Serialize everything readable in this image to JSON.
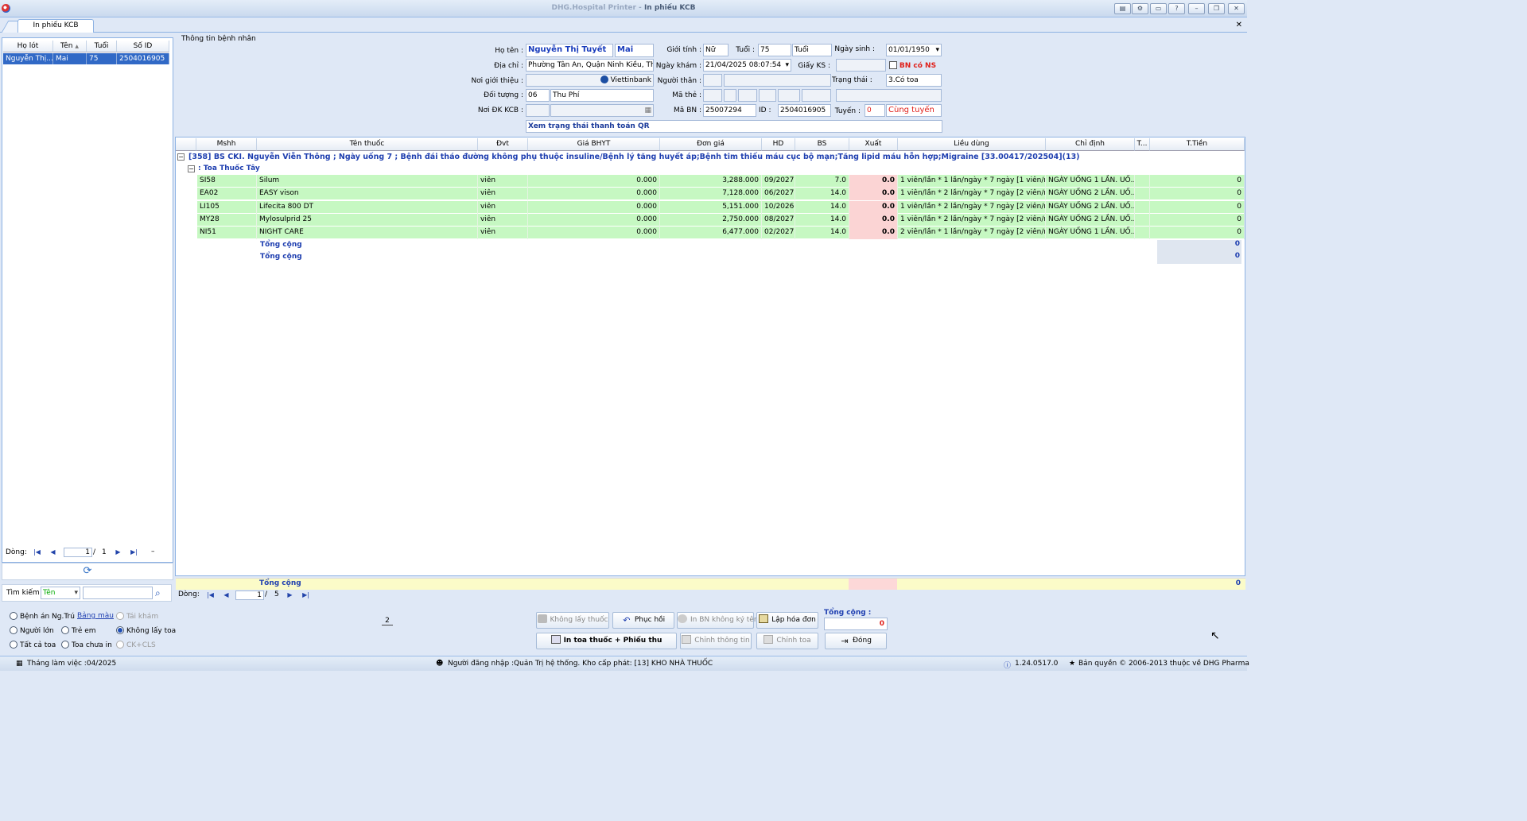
{
  "window": {
    "title_prefix": "DHG.Hospital Printer - ",
    "title": "In phiếu KCB"
  },
  "tab": {
    "label": "In phiếu KCB"
  },
  "patient_list": {
    "headers": [
      "Họ lót",
      "Tên",
      "Tuổi",
      "Số ID"
    ],
    "rows": [
      {
        "ho_lot": "Nguyễn Thị...",
        "ten": "Mai",
        "tuoi": "75",
        "so_id": "2504016905"
      }
    ],
    "nav_label": "Dòng:",
    "page": "1",
    "sep": "/",
    "total": "1",
    "minus": "–"
  },
  "search": {
    "label": "Tìm kiếm :",
    "field": "Tên",
    "value": ""
  },
  "patient_info": {
    "section_title": "Thông tin bệnh nhân",
    "ho_ten_label": "Họ tên :",
    "ho_ten": "Nguyễn Thị Tuyết",
    "ten": "Mai",
    "gioi_tinh_label": "Giới tính :",
    "gioi_tinh": "Nữ",
    "tuoi_label": "Tuổi :",
    "tuoi": "75",
    "tuoi_unit": "Tuổi",
    "ngay_sinh_label": "Ngày sinh :",
    "ngay_sinh": "01/01/1950",
    "dia_chi_label": "Địa chỉ :",
    "dia_chi": "Phường Tân An, Quận Ninh Kiều, Thành",
    "ngay_kham_label": "Ngày khám :",
    "ngay_kham": "21/04/2025 08:07:54",
    "giay_ks_label": "Giấy KS :",
    "bn_co_ns": "BN có NS",
    "noi_gioi_thieu_label": "Nơi giới thiệu :",
    "bank": "Viettinbank",
    "nguoi_than_label": "Người thân :",
    "trang_thai_label": "Trạng thái :",
    "trang_thai": "3.Có toa",
    "doi_tuong_label": "Đối tượng :",
    "doi_tuong_code": "06",
    "doi_tuong": "Thu Phí",
    "ma_the_label": "Mã thẻ :",
    "noi_dk_label": "Nơi ĐK KCB :",
    "ma_bn_label": "Mã BN :",
    "ma_bn": "25007294",
    "id_label": "ID :",
    "id": "2504016905",
    "tuyen_label": "Tuyến :",
    "tuyen_code": "0",
    "tuyen": "Cùng tuyến",
    "qr_link": "Xem trạng thái thanh toán QR"
  },
  "grid": {
    "headers": [
      "Mshh",
      "Tên thuốc",
      "Đvt",
      "Giá BHYT",
      "Đơn giá",
      "HD",
      "BS",
      "Xuất",
      "Liều dùng",
      "Chỉ định",
      "T...",
      "T.Tiền"
    ],
    "group_title": "[358] BS CKI. Nguyễn Viễn Thông ; Ngày uống 7 ; Bệnh đái tháo đường không phụ thuộc insuline/Bệnh lý tăng huyết áp;Bệnh tim thiếu máu cục bộ mạn;Tăng lipid máu hỗn hợp;Migraine [33.00417/202504](13)",
    "subgroup_title": ": Toa Thuốc Tây",
    "rows": [
      {
        "mshh": "SI58",
        "ten": "Silum",
        "dvt": "viên",
        "gia_bhyt": "0.000",
        "don_gia": "3,288.000",
        "hd": "09/2027",
        "bs": "7.0",
        "xuat": "0.0",
        "lieu": "1 viên/lần * 1 lần/ngày * 7 ngày [1 viên/n...",
        "chi_dinh": "NGÀY UỐNG 1 LẦN. UỐ...",
        "t": "",
        "tien": "0"
      },
      {
        "mshh": "EA02",
        "ten": "EASY vison",
        "dvt": "viên",
        "gia_bhyt": "0.000",
        "don_gia": "7,128.000",
        "hd": "06/2027",
        "bs": "14.0",
        "xuat": "0.0",
        "lieu": "1 viên/lần * 2 lần/ngày * 7 ngày [2 viên/n...",
        "chi_dinh": "NGÀY UỐNG 2 LẦN. UỐ...",
        "t": "",
        "tien": "0"
      },
      {
        "mshh": "LI105",
        "ten": "Lifecita 800 DT",
        "dvt": "viên",
        "gia_bhyt": "0.000",
        "don_gia": "5,151.000",
        "hd": "10/2026",
        "bs": "14.0",
        "xuat": "0.0",
        "lieu": "1 viên/lần * 2 lần/ngày * 7 ngày [2 viên/n...",
        "chi_dinh": "NGÀY UỐNG 2 LẦN. UỐ...",
        "t": "",
        "tien": "0"
      },
      {
        "mshh": "MY28",
        "ten": "Mylosulprid 25",
        "dvt": "viên",
        "gia_bhyt": "0.000",
        "don_gia": "2,750.000",
        "hd": "08/2027",
        "bs": "14.0",
        "xuat": "0.0",
        "lieu": "1 viên/lần * 2 lần/ngày * 7 ngày [2 viên/n...",
        "chi_dinh": "NGÀY UỐNG 2 LẦN. UỐ...",
        "t": "",
        "tien": "0"
      },
      {
        "mshh": "NI51",
        "ten": "NIGHT CARE",
        "dvt": "viên",
        "gia_bhyt": "0.000",
        "don_gia": "6,477.000",
        "hd": "02/2027",
        "bs": "14.0",
        "xuat": "0.0",
        "lieu": "2 viên/lần * 1 lần/ngày * 7 ngày [2 viên/n...",
        "chi_dinh": "NGÀY UỐNG 1 LẦN. UỐ...",
        "t": "",
        "tien": "0"
      }
    ],
    "subtotal_label": "Tổng cộng",
    "subtotal_value": "0",
    "total_label": "Tổng cộng",
    "total_value": "0",
    "footer_label": "Tổng cộng",
    "footer_value": "0",
    "nav_label": "Dòng:",
    "page": "1",
    "sep": "/",
    "total_pages": "5"
  },
  "options": {
    "benh_an": "Bệnh án Ng.Trú",
    "bang_mau": "Bảng màu",
    "tai_kham": "Tái khám",
    "nguoi_lon": "Người lớn",
    "tre_em": "Trẻ em",
    "khong_lay_toa": "Không lấy toa",
    "tat_ca_toa": "Tất cả toa",
    "toa_chua_in": "Toa chưa in",
    "ck_cls": "CK+CLS"
  },
  "page_indicator": "2",
  "actions": {
    "khong_lay_thuoc": "Không lấy thuốc",
    "phuc_hoi": "Phục hồi",
    "in_bn_khong_ky_ten": "In BN không ký tên",
    "lap_hoa_don": "Lập hóa đơn",
    "in_toa": "In toa thuốc + Phiếu thu",
    "chinh_thong_tin": "Chỉnh thông tin",
    "chinh_toa": "Chỉnh toa",
    "dong": "Đóng",
    "tong_cong_label": "Tổng cộng :",
    "tong_cong_value": "0"
  },
  "status": {
    "thang_lam_viec": "Tháng làm việc :04/2025",
    "nguoi_dang_nhap": "Người đăng nhập :Quản Trị hệ thống. Kho cấp phát: [13] KHO NHÀ THUỐC",
    "version": "1.24.0517.0",
    "copyright": "Bản quyền © 2006-2013 thuộc về DHG Pharma"
  }
}
